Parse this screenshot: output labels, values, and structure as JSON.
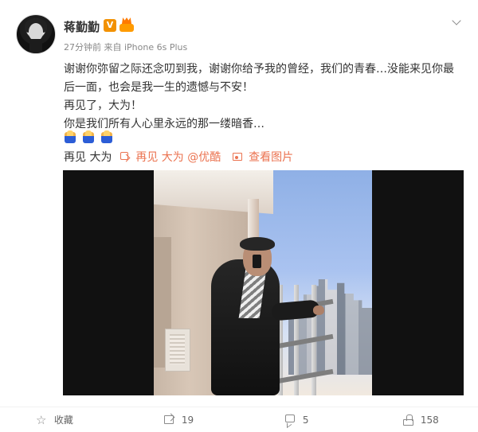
{
  "post": {
    "author": "蒋勤勤",
    "verified_badge": "V",
    "meta_text": "27分钟前 来自 iPhone 6s Plus",
    "content_lines": [
      "谢谢你弥留之际还念叨到我，谢谢你给予我的曾经，我们的青春…没能来见你最",
      "后一面，也会是我一生的遗憾与不安！",
      "再见了，大为！",
      "你是我们所有人心里永远的那一缕暗香…"
    ],
    "media_line": {
      "prefix": "再见 大为",
      "video_link": "再见 大为 @优酷",
      "image_link": "查看图片"
    }
  },
  "footer": {
    "favorite_label": "收藏",
    "repost_count": "19",
    "comment_count": "5",
    "like_count": "158"
  },
  "colors": {
    "link": "#eb7350",
    "text": "#333333",
    "meta": "#888888"
  },
  "icons": {
    "more": "chevron-down-icon",
    "favorite": "star-icon",
    "repost": "repost-icon",
    "comment": "comment-icon",
    "like": "thumbs-up-icon"
  }
}
